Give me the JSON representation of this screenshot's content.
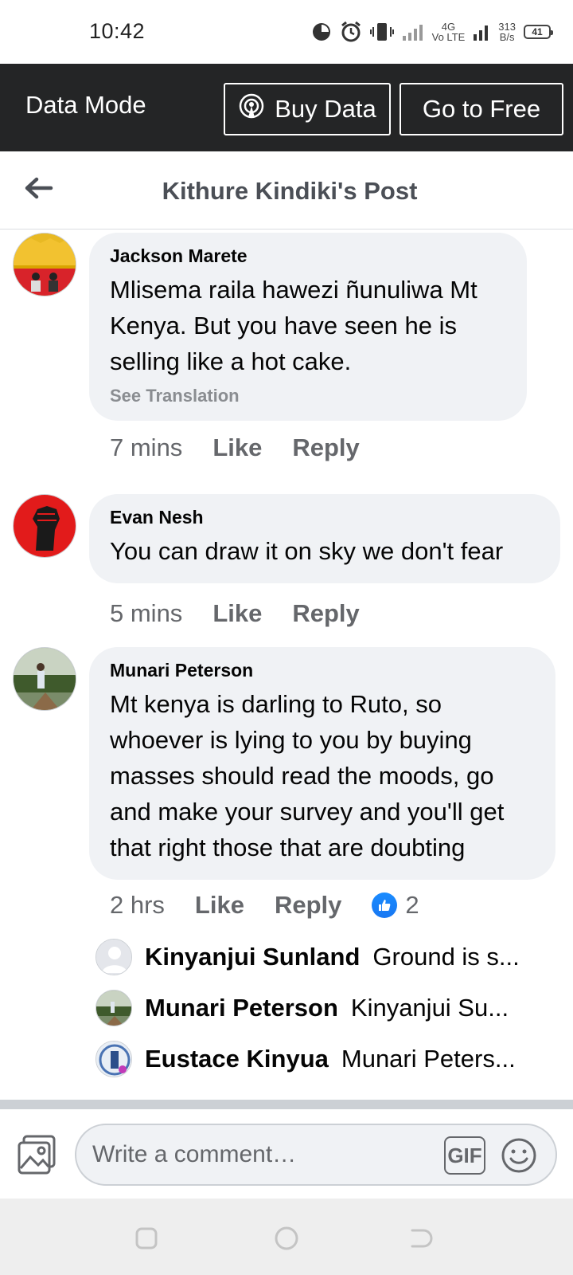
{
  "status_bar": {
    "time": "10:42",
    "network_label": "Vo LTE",
    "network_gen": "4G",
    "speed_value": "313",
    "speed_unit": "B/s",
    "battery": "41"
  },
  "data_mode_bar": {
    "title": "Data Mode",
    "buy_data_label": "Buy Data",
    "go_free_label": "Go to Free"
  },
  "header": {
    "title": "Kithure Kindiki's Post"
  },
  "comments": [
    {
      "author": "Jackson Marete",
      "text": "Mlisema raila hawezi ñunuliwa Mt Kenya. But you have seen he is selling like a hot cake.",
      "see_translation": "See Translation",
      "time": "7 mins",
      "like": "Like",
      "reply": "Reply"
    },
    {
      "author": "Evan Nesh",
      "text": "You can draw it on sky we don't fear",
      "time": "5 mins",
      "like": "Like",
      "reply": "Reply"
    },
    {
      "author": "Munari Peterson",
      "text": "Mt kenya is darling to Ruto, so whoever is lying to you by buying masses should read the moods, go and make your survey and you'll get that right those that are doubting",
      "time": "2 hrs",
      "like": "Like",
      "reply": "Reply",
      "like_count": "2"
    }
  ],
  "replies": [
    {
      "name": "Kinyanjui Sunland",
      "text": "Ground is s..."
    },
    {
      "name": "Munari Peterson",
      "text": "Kinyanjui Su..."
    },
    {
      "name": "Eustace Kinyua",
      "text": "Munari Peters..."
    }
  ],
  "composer": {
    "placeholder": "Write a comment…",
    "gif_label": "GIF"
  },
  "colors": {
    "facebook_blue": "#1877f2",
    "data_bar": "#242526",
    "bubble": "#f0f2f5",
    "secondary_text": "#65676b"
  },
  "icons": [
    "pie-chart-icon",
    "alarm-icon",
    "vibrate-icon",
    "signal-icon",
    "battery-icon",
    "broadcast-icon",
    "back-arrow-icon",
    "like-thumb-icon",
    "photo-icon",
    "emoji-icon",
    "recent-apps-icon",
    "home-icon",
    "back-nav-icon"
  ]
}
